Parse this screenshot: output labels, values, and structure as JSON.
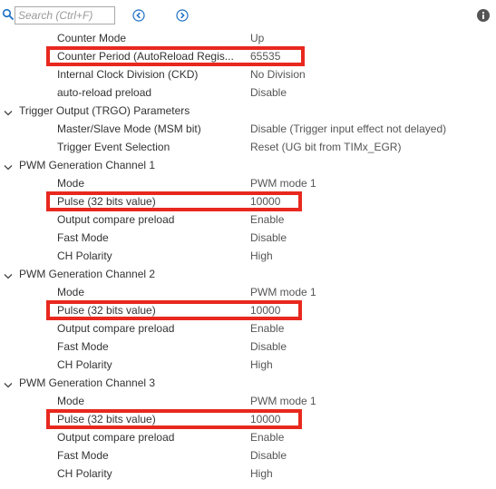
{
  "toolbar": {
    "search_placeholder": "Search (Ctrl+F)",
    "icons": [
      "search-icon",
      "back-arrow-icon",
      "forward-arrow-icon",
      "info-icon"
    ],
    "accent": "#1a6fc6"
  },
  "highlight_color": "#e8281e",
  "tree": [
    {
      "kind": "param",
      "label": "Counter Mode",
      "value": "Up"
    },
    {
      "kind": "param",
      "label": "Counter Period (AutoReload Regis...",
      "value": "65535",
      "highlighted": true
    },
    {
      "kind": "param",
      "label": "Internal Clock Division (CKD)",
      "value": "No Division"
    },
    {
      "kind": "param",
      "label": "auto-reload preload",
      "value": "Disable"
    },
    {
      "kind": "group",
      "label": "Trigger Output (TRGO) Parameters"
    },
    {
      "kind": "param",
      "label": "Master/Slave Mode (MSM bit)",
      "value": "Disable (Trigger input effect not delayed)"
    },
    {
      "kind": "param",
      "label": "Trigger Event Selection",
      "value": "Reset (UG bit from TIMx_EGR)"
    },
    {
      "kind": "group",
      "label": "PWM Generation Channel 1"
    },
    {
      "kind": "param",
      "label": "Mode",
      "value": "PWM mode 1"
    },
    {
      "kind": "param",
      "label": "Pulse (32 bits value)",
      "value": "10000",
      "highlighted": true
    },
    {
      "kind": "param",
      "label": "Output compare preload",
      "value": "Enable"
    },
    {
      "kind": "param",
      "label": "Fast Mode",
      "value": "Disable"
    },
    {
      "kind": "param",
      "label": "CH Polarity",
      "value": "High"
    },
    {
      "kind": "group",
      "label": "PWM Generation Channel 2"
    },
    {
      "kind": "param",
      "label": "Mode",
      "value": "PWM mode 1"
    },
    {
      "kind": "param",
      "label": "Pulse (32 bits value)",
      "value": "10000",
      "highlighted": true
    },
    {
      "kind": "param",
      "label": "Output compare preload",
      "value": "Enable"
    },
    {
      "kind": "param",
      "label": "Fast Mode",
      "value": "Disable"
    },
    {
      "kind": "param",
      "label": "CH Polarity",
      "value": "High"
    },
    {
      "kind": "group",
      "label": "PWM Generation Channel 3"
    },
    {
      "kind": "param",
      "label": "Mode",
      "value": "PWM mode 1"
    },
    {
      "kind": "param",
      "label": "Pulse (32 bits value)",
      "value": "10000",
      "highlighted": true
    },
    {
      "kind": "param",
      "label": "Output compare preload",
      "value": "Enable"
    },
    {
      "kind": "param",
      "label": "Fast Mode",
      "value": "Disable"
    },
    {
      "kind": "param",
      "label": "CH Polarity",
      "value": "High"
    }
  ]
}
